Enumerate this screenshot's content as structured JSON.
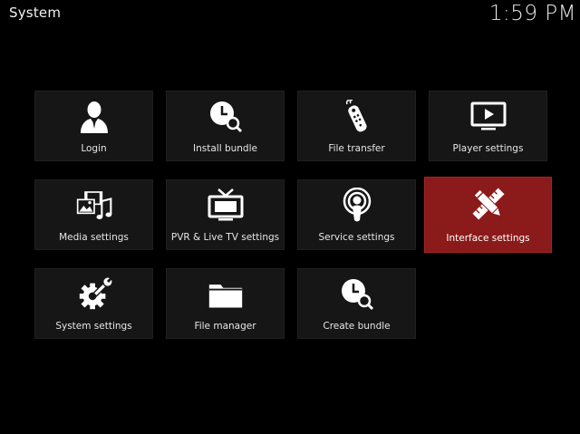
{
  "header": {
    "title": "System",
    "clock": "1:59 PM"
  },
  "tiles": [
    {
      "label": "Login",
      "icon": "user-icon"
    },
    {
      "label": "Install bundle",
      "icon": "clock-search-icon"
    },
    {
      "label": "File transfer",
      "icon": "remote-control-icon"
    },
    {
      "label": "Player settings",
      "icon": "tv-play-icon"
    },
    {
      "label": "Media settings",
      "icon": "media-icon"
    },
    {
      "label": "PVR & Live TV settings",
      "icon": "tv-antenna-icon"
    },
    {
      "label": "Service settings",
      "icon": "podcast-icon"
    },
    {
      "label": "Interface settings",
      "icon": "pencil-ruler-icon",
      "focused": true
    },
    {
      "label": "System settings",
      "icon": "gear-wrench-icon"
    },
    {
      "label": "File manager",
      "icon": "folder-icon"
    },
    {
      "label": "Create bundle",
      "icon": "clock-search-icon"
    }
  ],
  "colors": {
    "focus": "#8b1a1a",
    "tile": "#161616",
    "background": "#000000"
  }
}
